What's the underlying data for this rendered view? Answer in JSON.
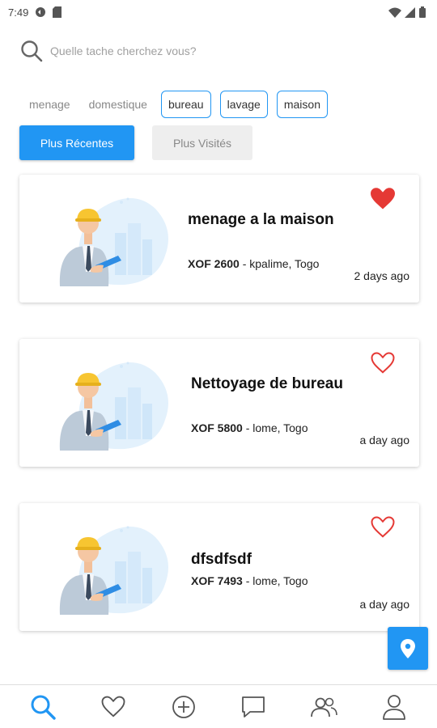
{
  "status_bar": {
    "time": "7:49"
  },
  "search": {
    "placeholder": "Quelle tache cherchez vous?"
  },
  "categories": [
    {
      "label": "menage",
      "style": "plain"
    },
    {
      "label": "domestique",
      "style": "plain"
    },
    {
      "label": "bureau",
      "style": "outlined"
    },
    {
      "label": "lavage",
      "style": "outlined"
    },
    {
      "label": "maison",
      "style": "outlined"
    }
  ],
  "sort": {
    "recent_label": "Plus Récentes",
    "visited_label": "Plus Visités"
  },
  "tasks": [
    {
      "title": "menage a la maison",
      "price": "XOF 2600",
      "location": " - kpalime, Togo",
      "time": "2 days ago",
      "favorite": true
    },
    {
      "title": "Nettoyage de bureau",
      "price": "XOF 5800",
      "location": " - lome, Togo",
      "time": "a day ago",
      "favorite": false
    },
    {
      "title": "dfsdfsdf",
      "price": "XOF 7493",
      "location": " - lome, Togo",
      "time": "a day ago",
      "favorite": false
    }
  ],
  "colors": {
    "accent": "#2196f3",
    "favorite": "#e53935"
  },
  "bottom_nav": [
    "search-icon",
    "heart-icon",
    "add-icon",
    "chat-icon",
    "group-icon",
    "profile-icon"
  ]
}
